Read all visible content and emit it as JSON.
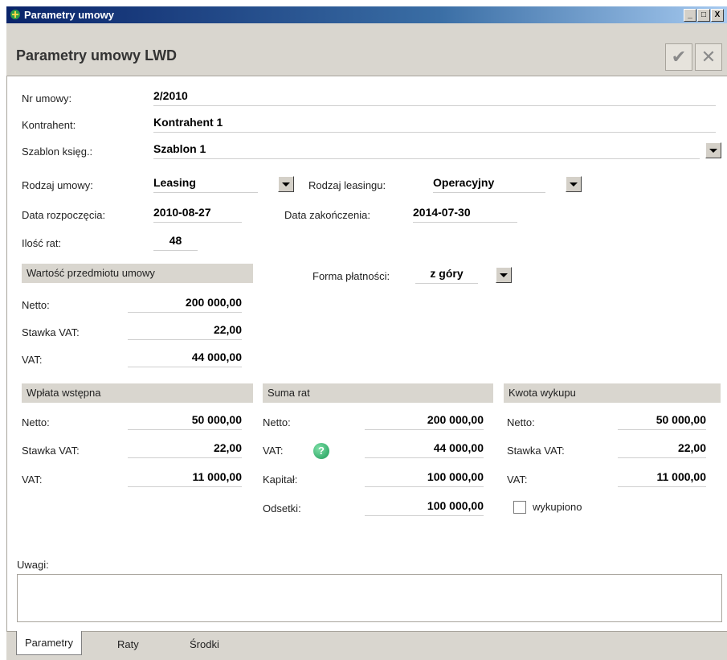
{
  "window": {
    "title": "Parametry umowy",
    "minimize": "_",
    "maximize": "□",
    "close": "X"
  },
  "header": {
    "title": "Parametry umowy LWD",
    "confirm_icon": "check-icon",
    "cancel_icon": "close-icon"
  },
  "contract": {
    "nr_label": "Nr umowy:",
    "nr_value": "2/2010",
    "kontrahent_label": "Kontrahent:",
    "kontrahent_value": "Kontrahent 1",
    "szablon_label": "Szablon księg.:",
    "szablon_value": "Szablon 1",
    "rodzaj_label": "Rodzaj umowy:",
    "rodzaj_value": "Leasing",
    "rodzaj_leasingu_label": "Rodzaj leasingu:",
    "rodzaj_leasingu_value": "Operacyjny",
    "data_rozp_label": "Data rozpoczęcia:",
    "data_rozp_value": "2010-08-27",
    "data_zak_label": "Data zakończenia:",
    "data_zak_value": "2014-07-30",
    "ilosc_rat_label": "Ilość rat:",
    "ilosc_rat_value": "48",
    "forma_label": "Forma płatności:",
    "forma_value": "z góry"
  },
  "wartosc": {
    "title": "Wartość przedmiotu umowy",
    "netto_label": "Netto:",
    "netto_value": "200 000,00",
    "stawka_label": "Stawka VAT:",
    "stawka_value": "22,00",
    "vat_label": "VAT:",
    "vat_value": "44 000,00"
  },
  "wplata": {
    "title": "Wpłata wstępna",
    "netto_label": "Netto:",
    "netto_value": "50 000,00",
    "stawka_label": "Stawka VAT:",
    "stawka_value": "22,00",
    "vat_label": "VAT:",
    "vat_value": "11 000,00"
  },
  "suma": {
    "title": "Suma rat",
    "netto_label": "Netto:",
    "netto_value": "200 000,00",
    "vat_label": "VAT:",
    "vat_value": "44 000,00",
    "help_glyph": "?",
    "kapital_label": "Kapitał:",
    "kapital_value": "100 000,00",
    "odsetki_label": "Odsetki:",
    "odsetki_value": "100 000,00"
  },
  "wykup": {
    "title": "Kwota wykupu",
    "netto_label": "Netto:",
    "netto_value": "50 000,00",
    "stawka_label": "Stawka VAT:",
    "stawka_value": "22,00",
    "vat_label": "VAT:",
    "vat_value": "11 000,00",
    "wykupiono_label": "wykupiono",
    "wykupiono_checked": false
  },
  "uwagi": {
    "label": "Uwagi:",
    "value": ""
  },
  "tabs": [
    {
      "label": "Parametry"
    },
    {
      "label": "Raty"
    },
    {
      "label": "Środki"
    }
  ]
}
